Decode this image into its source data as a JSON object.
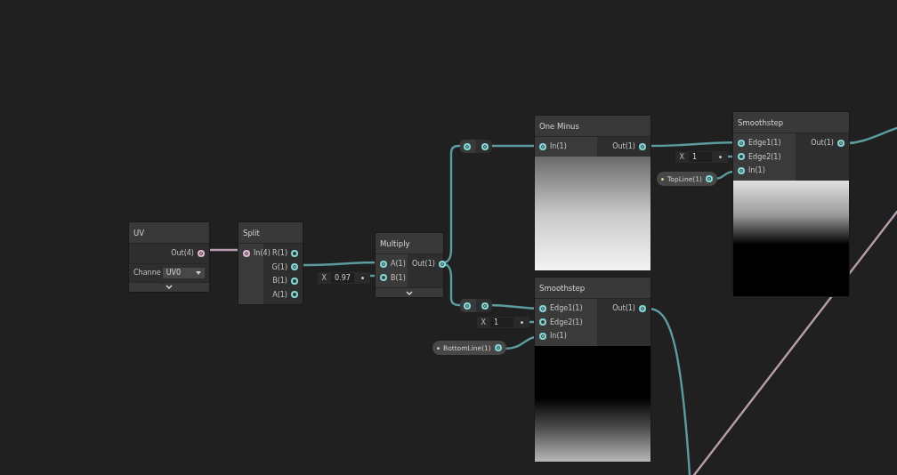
{
  "nodes": [
    {
      "title": "UV",
      "outputs": [
        {
          "label": "Out(4)",
          "connected": true,
          "color": "#e0b8d0"
        }
      ],
      "controls": [
        {
          "kind": "dropdown",
          "label": "Channe",
          "value": "UV0"
        }
      ],
      "collapse_toggle": true
    },
    {
      "title": "Split",
      "inputs": [
        {
          "label": "In(4)",
          "connected": true,
          "color": "#e0b8d0"
        }
      ],
      "outputs": [
        {
          "label": "R(1)",
          "connected": false,
          "color": "#84d8d8"
        },
        {
          "label": "G(1)",
          "connected": true,
          "color": "#84d8d8"
        },
        {
          "label": "B(1)",
          "connected": false,
          "color": "#84d8d8"
        },
        {
          "label": "A(1)",
          "connected": false,
          "color": "#84d8d8"
        }
      ]
    },
    {
      "title": "Multiply",
      "inputs": [
        {
          "label": "A(1)",
          "connected": true,
          "color": "#84d8d8"
        },
        {
          "label": "B(1)",
          "connected": false,
          "color": "#84d8d8",
          "inline": {
            "axis": "X",
            "value": "0.97"
          }
        }
      ],
      "outputs": [
        {
          "label": "Out(1)",
          "connected": true,
          "color": "#84d8d8"
        }
      ],
      "collapse_toggle": true
    },
    {
      "title": "One Minus",
      "inputs": [
        {
          "label": "In(1)",
          "connected": true,
          "color": "#84d8d8"
        }
      ],
      "outputs": [
        {
          "label": "Out(1)",
          "connected": true,
          "color": "#84d8d8"
        }
      ],
      "preview": {
        "kind": "rise"
      }
    },
    {
      "title": "Smoothstep",
      "inputs": [
        {
          "label": "Edge1(1)",
          "connected": true,
          "color": "#84d8d8"
        },
        {
          "label": "Edge2(1)",
          "connected": false,
          "color": "#84d8d8",
          "inline": {
            "axis": "X",
            "value": "1"
          }
        },
        {
          "label": "In(1)",
          "connected": true,
          "color": "#84d8d8"
        }
      ],
      "outputs": [
        {
          "label": "Out(1)",
          "connected": true,
          "color": "#84d8d8"
        }
      ],
      "preview": {
        "kind": "late-rise"
      }
    },
    {
      "title": "Smoothstep",
      "inputs": [
        {
          "label": "Edge1(1)",
          "connected": true,
          "color": "#84d8d8"
        },
        {
          "label": "Edge2(1)",
          "connected": false,
          "color": "#84d8d8",
          "inline": {
            "axis": "X",
            "value": "1"
          }
        },
        {
          "label": "In(1)",
          "connected": true,
          "color": "#84d8d8"
        }
      ],
      "outputs": [
        {
          "label": "Out(1)",
          "connected": true,
          "color": "#84d8d8"
        }
      ],
      "preview": {
        "kind": "fall"
      }
    }
  ],
  "reroutes": [
    {
      "input_connected": true,
      "output_connected": true
    },
    {
      "input_connected": true,
      "output_connected": true
    }
  ],
  "properties": [
    {
      "label": "TopLine(1)",
      "connected": true
    },
    {
      "label": "BottomLine(1)",
      "connected": true
    }
  ]
}
